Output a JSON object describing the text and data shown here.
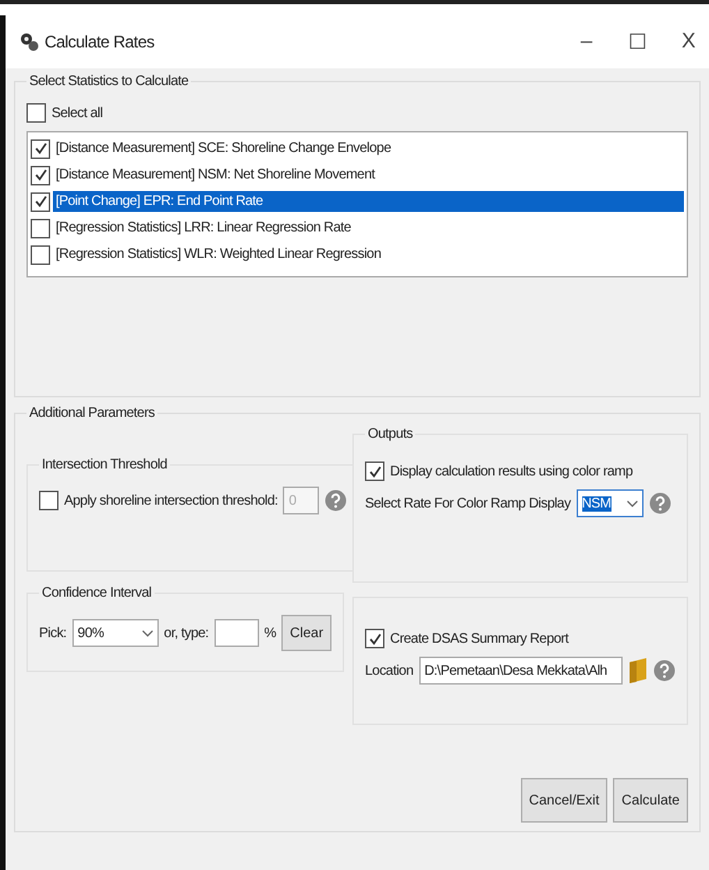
{
  "window": {
    "title": "Calculate Rates",
    "controls": [
      "–",
      "☐",
      "X"
    ]
  },
  "statistics": {
    "title": "Select Statistics to Calculate",
    "select_all": {
      "label": "Select all",
      "checked": false
    },
    "items": [
      {
        "label": "[Distance Measurement] SCE: Shoreline Change Envelope",
        "checked": true,
        "selected": false
      },
      {
        "label": "[Distance Measurement] NSM: Net Shoreline Movement",
        "checked": true,
        "selected": false
      },
      {
        "label": "[Point Change] EPR: End Point Rate",
        "checked": true,
        "selected": true
      },
      {
        "label": "[Regression Statistics] LRR: Linear Regression Rate",
        "checked": false,
        "selected": false
      },
      {
        "label": "[Regression Statistics] WLR: Weighted Linear Regression",
        "checked": false,
        "selected": false
      }
    ]
  },
  "additional": {
    "title": "Additional Parameters",
    "intersection": {
      "title": "Intersection Threshold",
      "checkbox": {
        "label": "Apply shoreline intersection threshold:",
        "checked": false
      },
      "value": "0",
      "disabled": true
    },
    "confidence": {
      "title": "Confidence Interval",
      "pick_label": "Pick:",
      "pick_value": "90%",
      "type_label": "or, type:",
      "percent": "%",
      "clear": "Clear"
    },
    "outputs": {
      "title": "Outputs",
      "color_ramp": {
        "label": "Display calculation results using color ramp",
        "checked": true
      },
      "rate_label": "Select Rate For Color Ramp Display",
      "rate_value": "NSM"
    },
    "report": {
      "checkbox": {
        "label": "Create DSAS Summary Report",
        "checked": true
      },
      "location_label": "Location",
      "location_value": "D:\\Pemetaan\\Desa Mekkata\\Alh"
    }
  },
  "buttons": [
    "Cancel/Exit",
    "Calculate"
  ]
}
